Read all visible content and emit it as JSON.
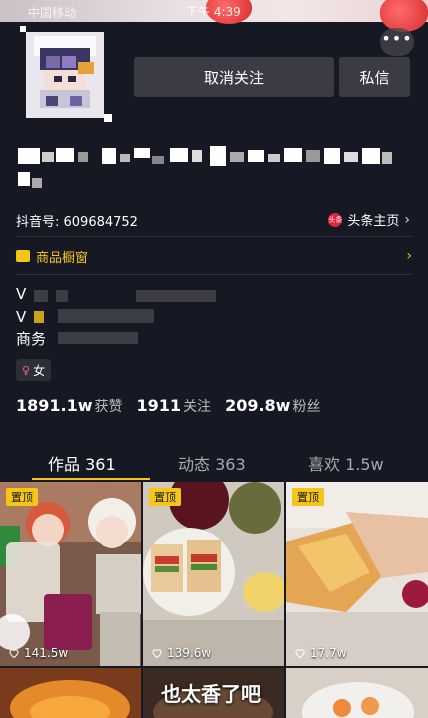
{
  "status_bar": {
    "carrier": "中国移动",
    "time": "下午 4:39",
    "right_text": ""
  },
  "profile": {
    "unfollow_label": "取消关注",
    "message_label": "私信",
    "douyin_id": "抖音号: 609684752",
    "toutiao_badge": "头条",
    "toutiao_label": "头条主页",
    "shop_label": "商品橱窗",
    "info_line1_prefix": "V",
    "info_line2_prefix": "V",
    "info_line3_prefix": "商务",
    "gender_label": "女",
    "gender_symbol": "♀"
  },
  "stats": [
    {
      "num": "1891.1w",
      "label": "获赞"
    },
    {
      "num": "1911",
      "label": "关注"
    },
    {
      "num": "209.8w",
      "label": "粉丝"
    }
  ],
  "tabs": [
    {
      "label": "作品 361"
    },
    {
      "label": "动态 363"
    },
    {
      "label": "喜欢 1.5w"
    }
  ],
  "grid": [
    {
      "pin": "置顶",
      "likes": "141.5w"
    },
    {
      "pin": "置顶",
      "likes": "139.6w"
    },
    {
      "pin": "置顶",
      "likes": "17.7w"
    },
    {
      "overlay": "也太香了吧"
    }
  ],
  "colors": {
    "background": "#161823",
    "accent": "#f5c518",
    "button": "#3a3b44"
  }
}
